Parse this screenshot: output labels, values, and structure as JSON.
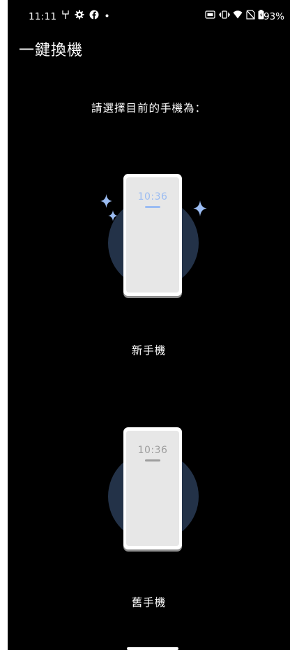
{
  "status_bar": {
    "time": "11:11",
    "battery_percent": "93%",
    "icons": [
      "usb-icon",
      "gear-icon",
      "facebook-icon",
      "dot-icon",
      "nfc-icon",
      "vibrate-icon",
      "wifi-icon",
      "no-sim-icon",
      "battery-icon"
    ]
  },
  "app_bar": {
    "title": "一鍵換機"
  },
  "prompt": "請選擇目前的手機為：",
  "options": [
    {
      "label": "新手機",
      "phone_time": "10:36",
      "accent": "#9bbcf2"
    },
    {
      "label": "舊手機",
      "phone_time": "10:36",
      "accent": "#9e9e9e"
    }
  ],
  "colors": {
    "background": "#000000",
    "circle": "#233248",
    "sparkle": "#9bbcf2"
  }
}
